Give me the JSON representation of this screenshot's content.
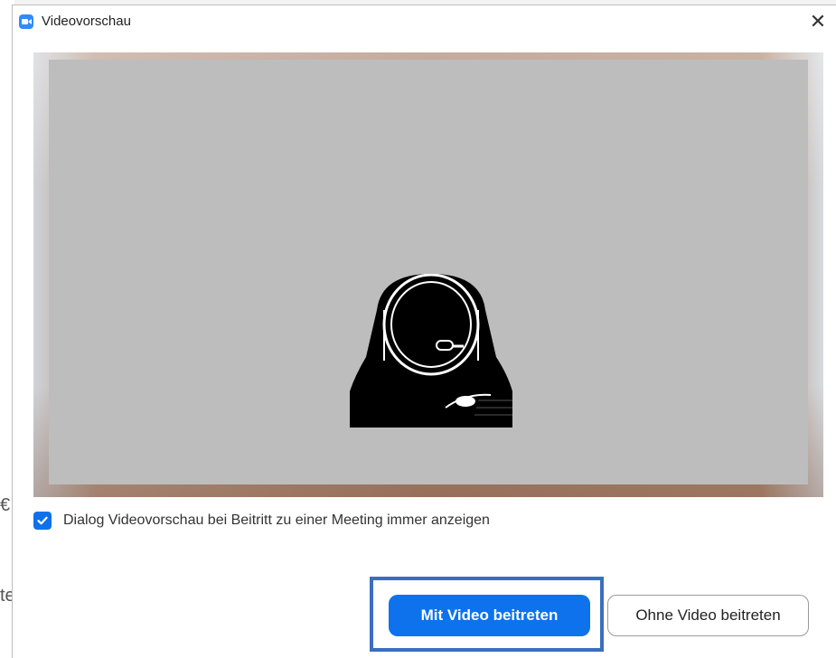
{
  "background": {
    "partial_text_1": "€",
    "partial_text_2": "te"
  },
  "dialog": {
    "title": "Videovorschau",
    "app_icon": "zoom-camera-icon",
    "close_icon": "close-icon",
    "close_glyph": "✕",
    "video_preview": {
      "avatar_icon": "astronaut-avatar-icon"
    },
    "checkbox": {
      "checked": true,
      "label": "Dialog Videovorschau bei Beitritt zu einer Meeting immer anzeigen"
    },
    "buttons": {
      "primary_label": "Mit Video beitreten",
      "secondary_label": "Ohne Video beitreten"
    }
  },
  "colors": {
    "accent": "#0e72ed",
    "highlight_border": "#3a6fbf",
    "avatar_bg": "#bdbdbd"
  }
}
